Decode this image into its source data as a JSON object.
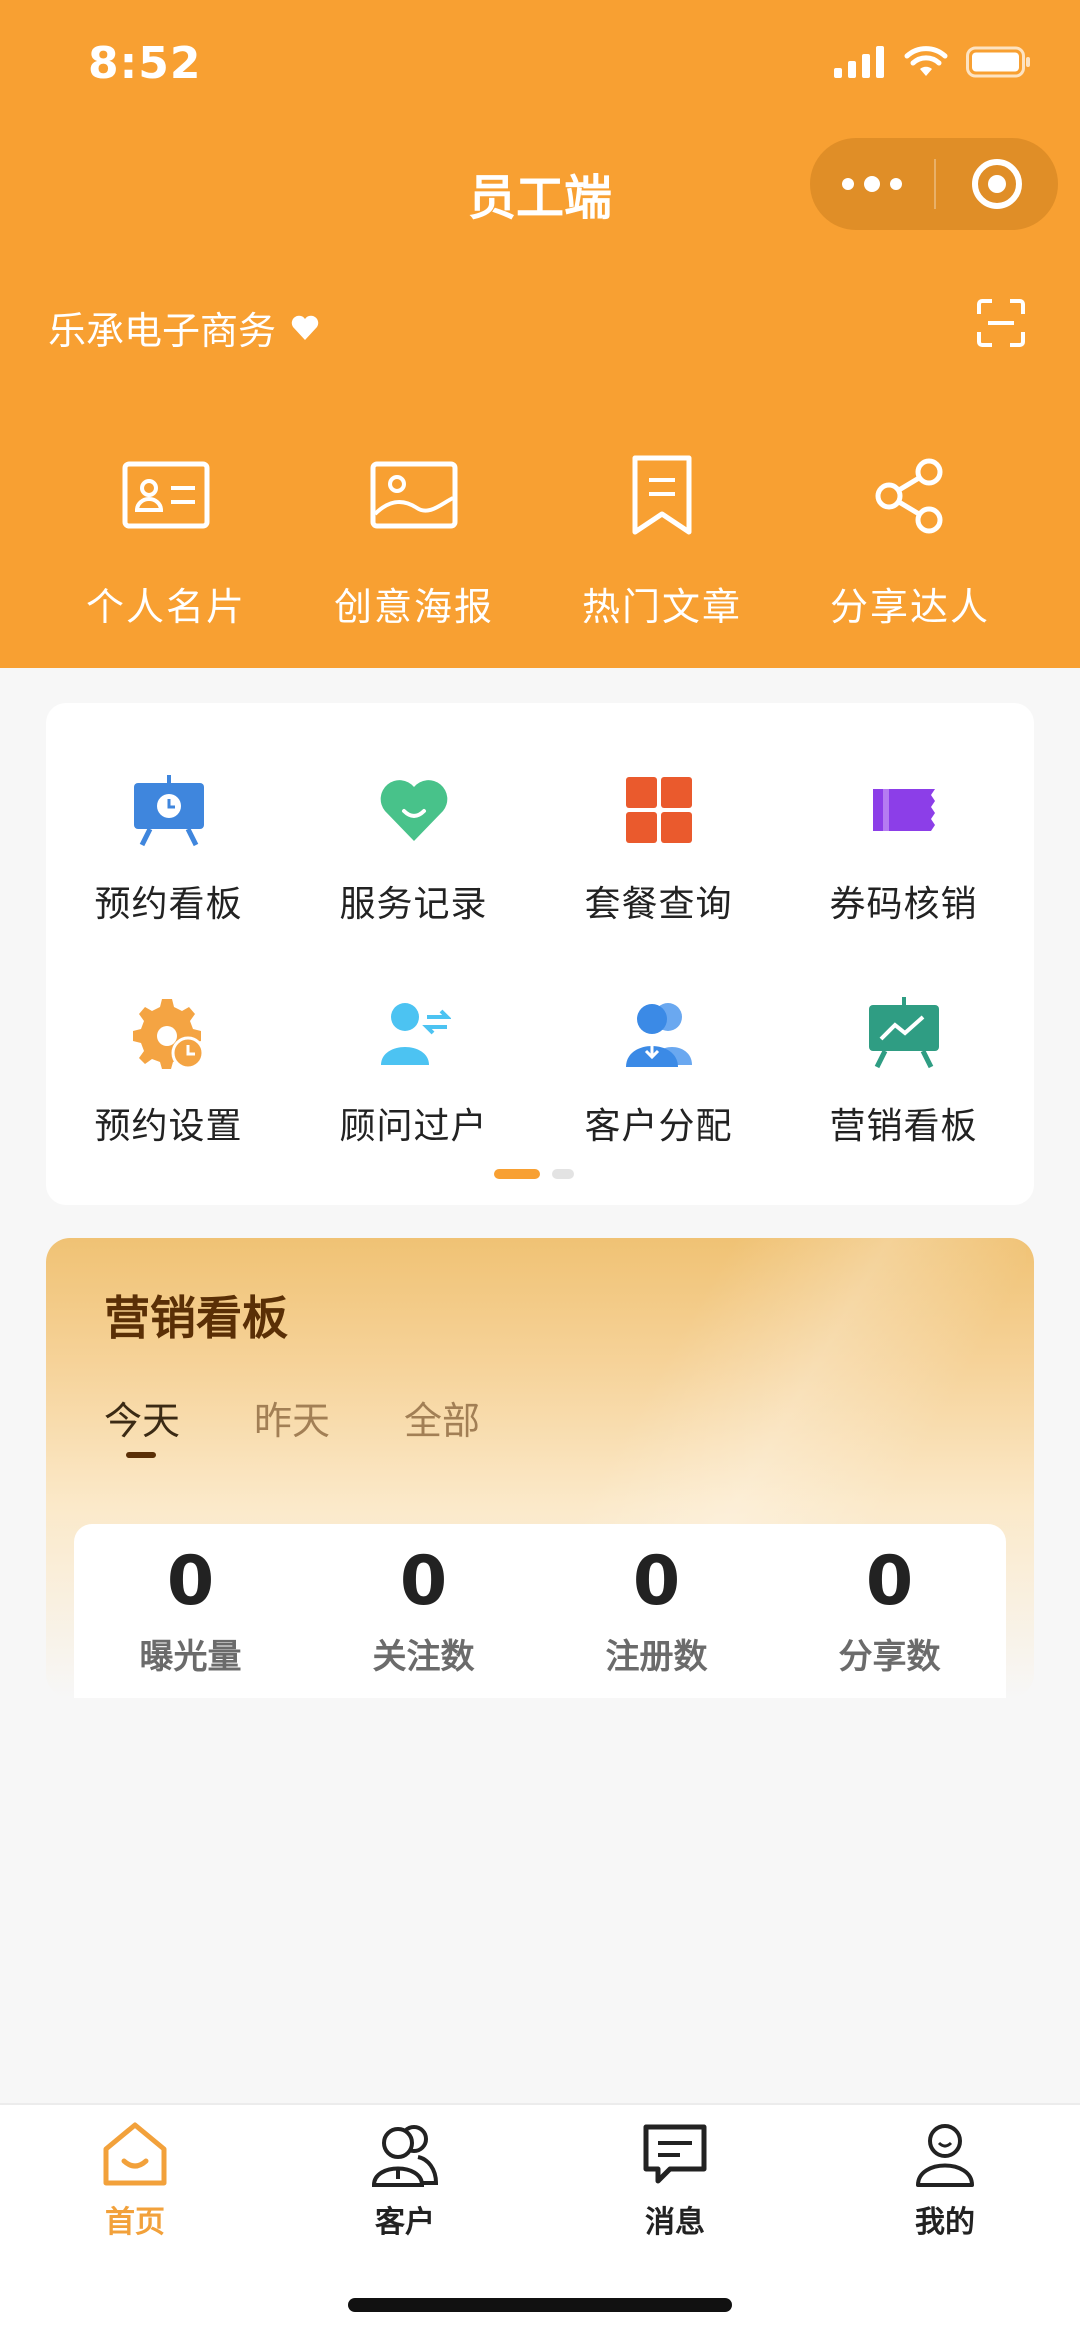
{
  "status_bar": {
    "time": "8:52"
  },
  "nav": {
    "title": "员工端"
  },
  "company": {
    "name": "乐承电子商务"
  },
  "quick_actions": [
    {
      "label": "个人名片",
      "icon": "business-card-icon"
    },
    {
      "label": "创意海报",
      "icon": "poster-image-icon"
    },
    {
      "label": "热门文章",
      "icon": "bookmark-article-icon"
    },
    {
      "label": "分享达人",
      "icon": "share-icon"
    }
  ],
  "grid": {
    "page_indicator": {
      "pages": 2,
      "current": 1
    },
    "row1": [
      {
        "label": "预约看板",
        "icon": "appointment-board-icon",
        "color": "#3f86dd"
      },
      {
        "label": "服务记录",
        "icon": "heart-icon",
        "color": "#48c28a"
      },
      {
        "label": "套餐查询",
        "icon": "grid-four-icon",
        "color": "#ea5a2d"
      },
      {
        "label": "券码核销",
        "icon": "ticket-icon",
        "color": "#8c3ee8"
      }
    ],
    "row2": [
      {
        "label": "预约设置",
        "icon": "gear-clock-icon",
        "color": "#f4a443"
      },
      {
        "label": "顾问过户",
        "icon": "user-transfer-icon",
        "color": "#4cc3f2"
      },
      {
        "label": "客户分配",
        "icon": "users-download-icon",
        "color": "#3b8ae6"
      },
      {
        "label": "营销看板",
        "icon": "chart-board-icon",
        "color": "#2f9d83"
      }
    ]
  },
  "board": {
    "title": "营销看板",
    "tabs": [
      "今天",
      "昨天",
      "全部"
    ],
    "active_tab": "今天",
    "stats": [
      {
        "value": "0",
        "label": "曝光量"
      },
      {
        "value": "0",
        "label": "关注数"
      },
      {
        "value": "0",
        "label": "注册数"
      },
      {
        "value": "0",
        "label": "分享数"
      }
    ]
  },
  "tabbar": [
    {
      "label": "首页",
      "icon": "home-icon",
      "active": true
    },
    {
      "label": "客户",
      "icon": "customers-icon",
      "active": false
    },
    {
      "label": "消息",
      "icon": "message-icon",
      "active": false
    },
    {
      "label": "我的",
      "icon": "profile-icon",
      "active": false
    }
  ],
  "colors": {
    "brand": "#f8a032",
    "tab_active": "#f2a13b",
    "board_title": "#5a2f06"
  }
}
